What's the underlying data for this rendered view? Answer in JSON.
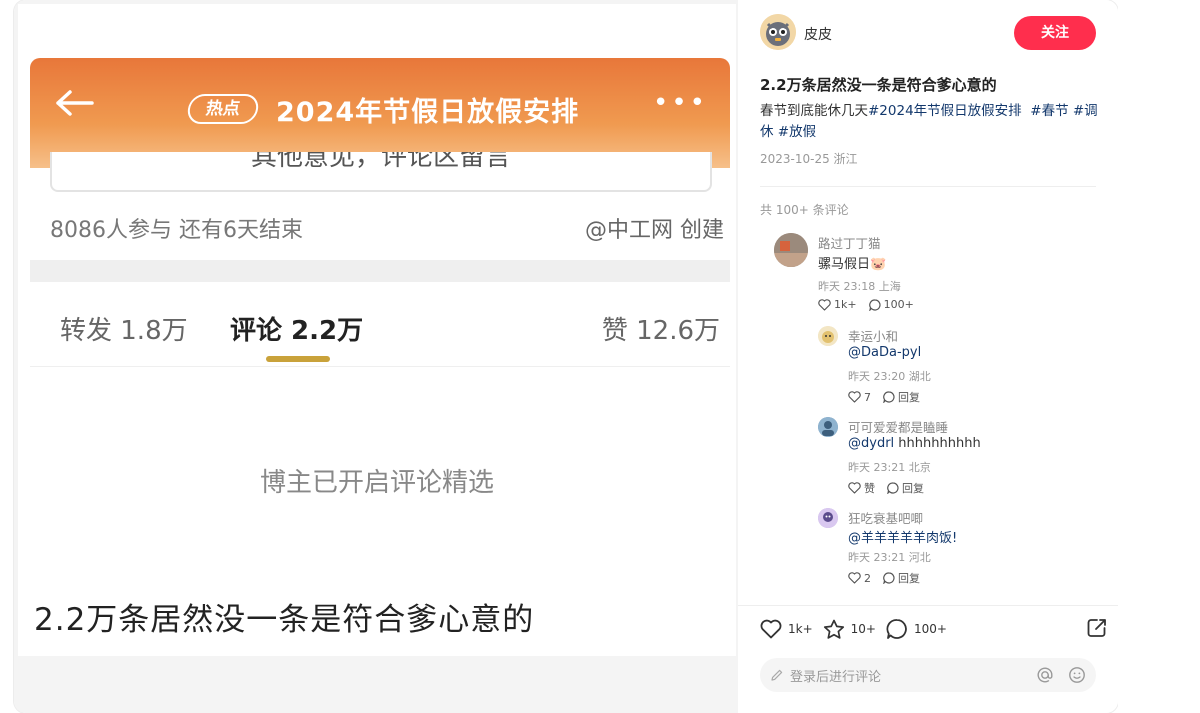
{
  "screenshot": {
    "hot_badge": "热点",
    "title": "2024年节假日放假安排",
    "input_text": "其他意见，评论区留言",
    "participants": "8086人参与  还有6天结束",
    "creator": "@中工网 创建",
    "tab_forward": "转发 1.8万",
    "tab_comment": "评论 2.2万",
    "tab_like": "赞 12.6万",
    "curated_notice": "博主已开启评论精选",
    "caption": "2.2万条居然没一条是符合爹心意的"
  },
  "author": {
    "name": "皮皮",
    "follow_label": "关注"
  },
  "post": {
    "title": "2.2万条居然没一条是符合爹心意的",
    "body_prefix": "春节到底能休几天",
    "tag1": "#2024年节假日放假安排",
    "tag2": "#春节",
    "tag3": "#调休",
    "tag4": "#放假",
    "meta": "2023-10-25 浙江"
  },
  "comments": {
    "total": "共 100+ 条评论",
    "items": [
      {
        "name": "路过丁丁猫",
        "text": "骡马假日🐷",
        "time": "昨天 23:18 上海",
        "likes": "1k+",
        "replies": "100+"
      },
      {
        "name": "幸运小和",
        "mention": "@DaDa-pyl",
        "time": "昨天 23:20 湖北",
        "likes": "7",
        "reply_label": "回复"
      },
      {
        "name": "可可爱爱都是瞌睡",
        "mention": "@dydrl",
        "text": " hhhhhhhhhh",
        "time": "昨天 23:21 北京",
        "likes": "赞",
        "reply_label": "回复"
      },
      {
        "name": "狂吃衰基吧唧",
        "mention": "@羊羊羊羊羊肉饭!",
        "time": "昨天 23:21 河北",
        "likes": "2",
        "reply_label": "回复"
      }
    ]
  },
  "engagement": {
    "likes": "1k+",
    "collects": "10+",
    "comments": "100+"
  },
  "comment_input": {
    "placeholder": "登录后进行评论"
  },
  "colors": {
    "accent": "#ff2e4d",
    "tag": "#13386c",
    "orange_header": "#e8773a"
  }
}
